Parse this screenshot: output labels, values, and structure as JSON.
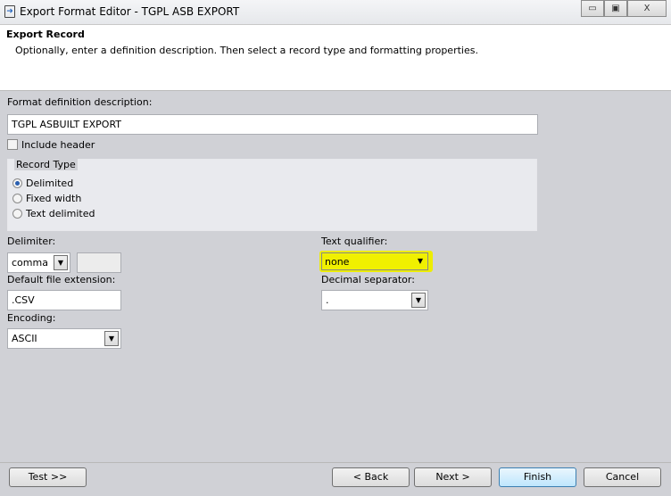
{
  "window": {
    "title": "Export Format Editor - TGPL ASB EXPORT",
    "minimize": "▭",
    "maximize": "▣",
    "close": "X"
  },
  "header": {
    "title": "Export Record",
    "subtitle": "Optionally, enter a definition description. Then select a record type and formatting properties."
  },
  "form": {
    "description_label": "Format definition description:",
    "description_value": "TGPL ASBUILT EXPORT",
    "include_header_label": "Include header",
    "record_type": {
      "legend": "Record Type",
      "options": [
        "Delimited",
        "Fixed width",
        "Text delimited"
      ],
      "selected": "Delimited"
    },
    "delimiter_label": "Delimiter:",
    "delimiter_value": "comma",
    "text_qualifier_label": "Text qualifier:",
    "text_qualifier_value": "none",
    "highlight_color": "#f2f200",
    "extension_label": "Default file extension:",
    "extension_value": ".CSV",
    "decimal_label": "Decimal separator:",
    "decimal_value": ".",
    "encoding_label": "Encoding:",
    "encoding_value": "ASCII"
  },
  "buttons": {
    "test": "Test >>",
    "back": "< Back",
    "next": "Next >",
    "finish": "Finish",
    "cancel": "Cancel"
  }
}
